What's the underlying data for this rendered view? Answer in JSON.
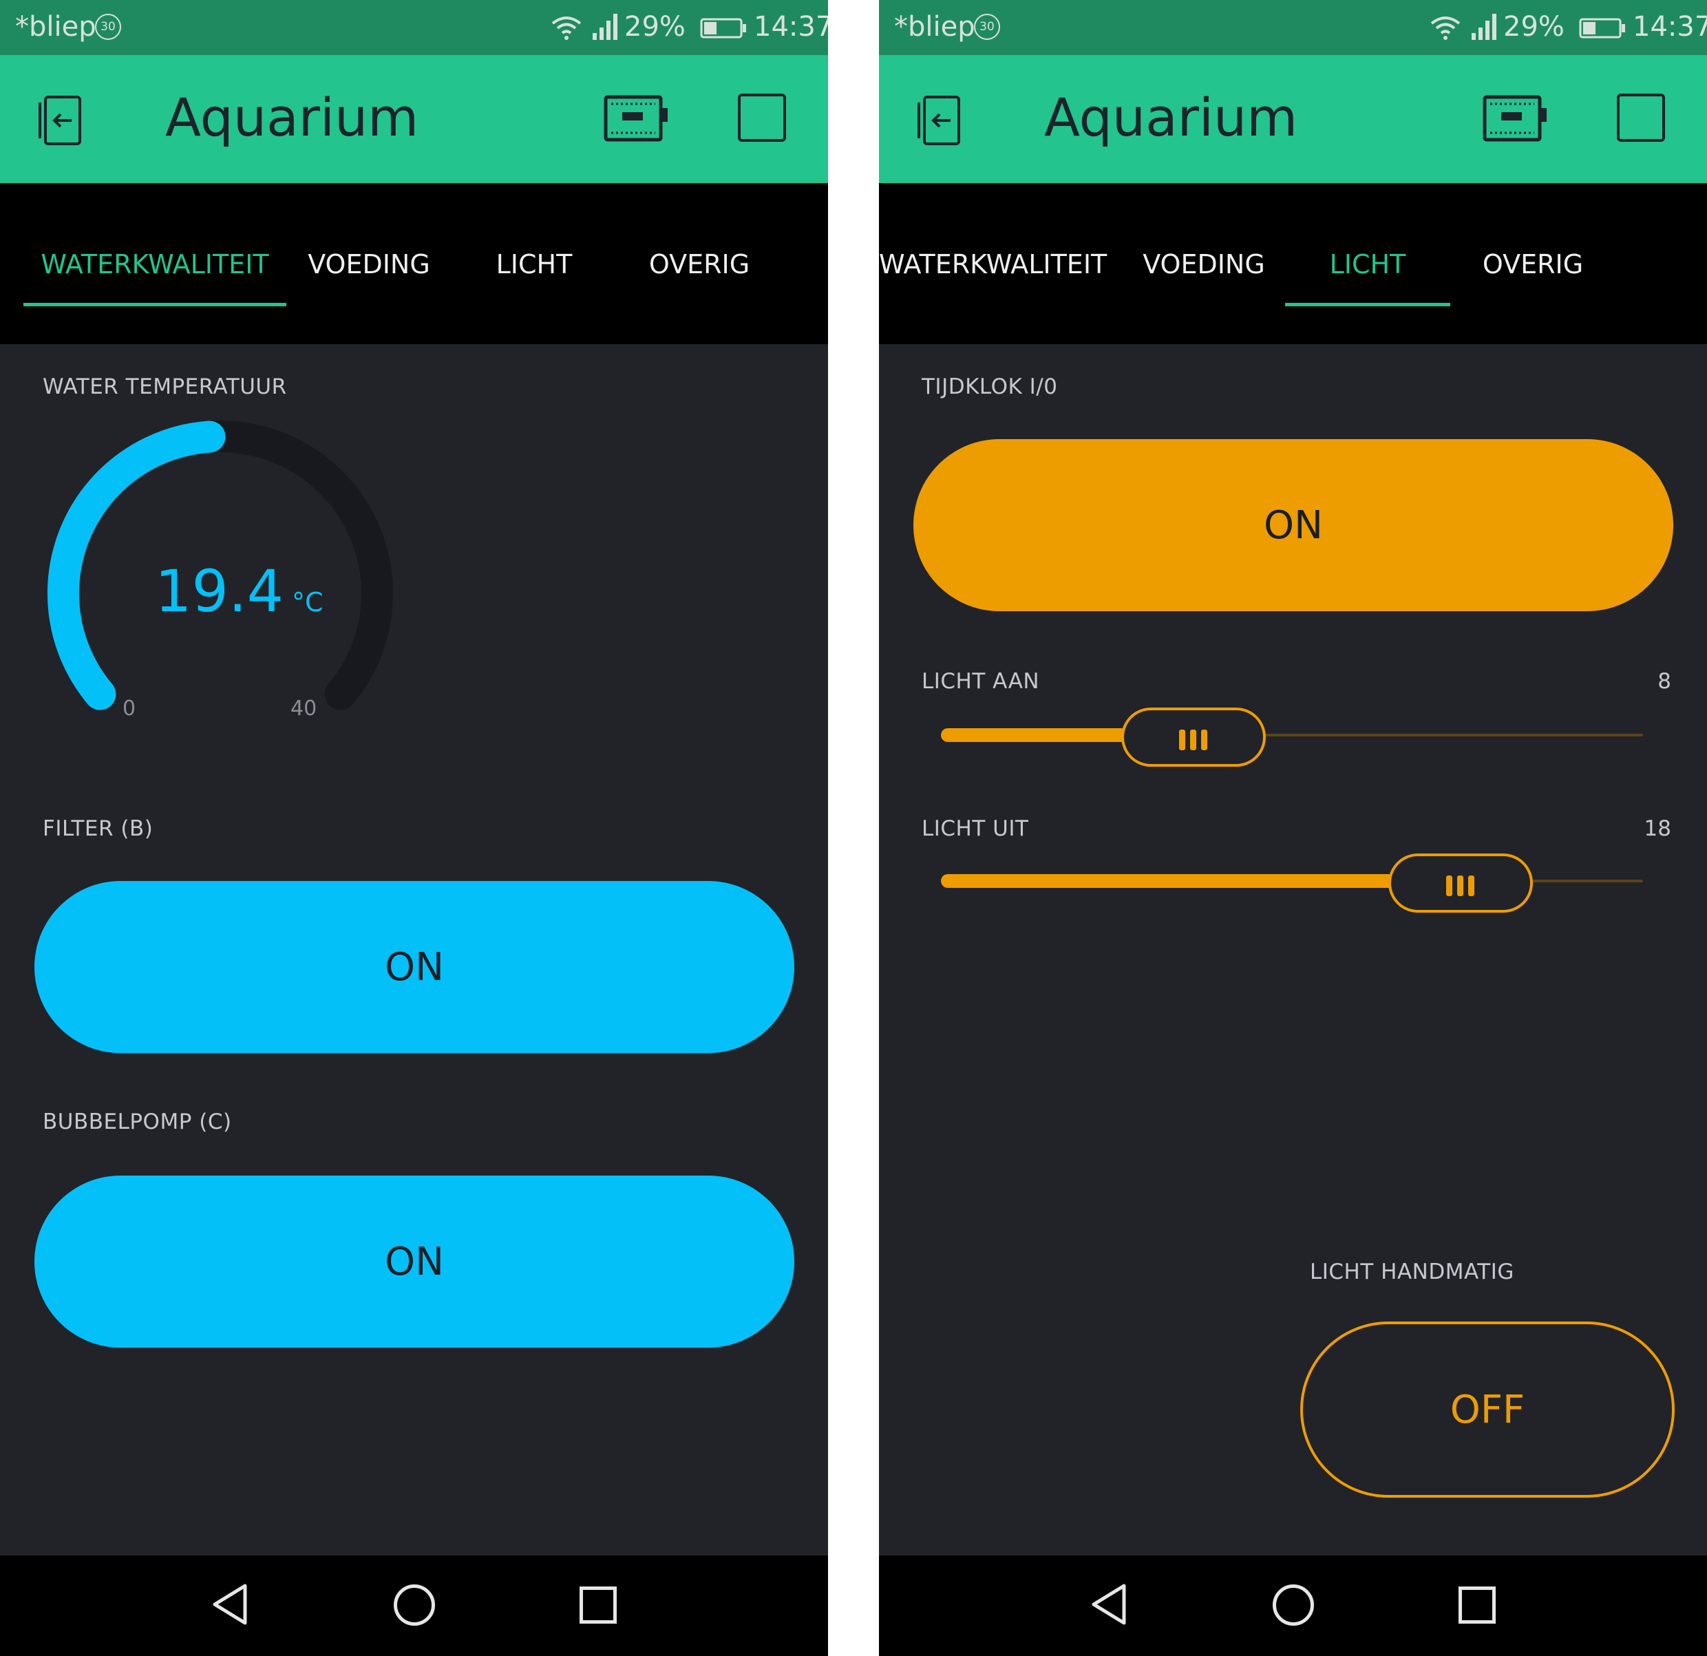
{
  "status_bar": {
    "carrier": "*bliep",
    "carrier_badge": "30",
    "battery_pct": "29%",
    "time": "14:37"
  },
  "app": {
    "title": "Aquarium"
  },
  "tabs": [
    "WATERKWALITEIT",
    "VOEDING",
    "LICHT",
    "OVERIG"
  ],
  "colors": {
    "accent_green": "#23c48e",
    "blue": "#04c0f8",
    "orange": "#ed9d00",
    "background": "#212329"
  },
  "left_screen": {
    "active_tab": "WATERKWALITEIT",
    "gauge": {
      "label": "WATER TEMPERATUUR",
      "value": "19.4",
      "unit": "°C",
      "min": "0",
      "max": "40",
      "fraction": 0.485
    },
    "filter": {
      "label": "FILTER (B)",
      "button": "ON"
    },
    "bubbelpomp": {
      "label": "BUBBELPOMP (C)",
      "button": "ON"
    }
  },
  "right_screen": {
    "active_tab": "LICHT",
    "tijdklok": {
      "label": "TIJDKLOK I/0",
      "button": "ON"
    },
    "licht_aan": {
      "label": "LICHT AAN",
      "value": "8",
      "fraction": 0.36
    },
    "licht_uit": {
      "label": "LICHT UIT",
      "value": "18",
      "fraction": 0.74
    },
    "licht_handmatig": {
      "label": "LICHT HANDMATIG",
      "button": "OFF"
    }
  }
}
